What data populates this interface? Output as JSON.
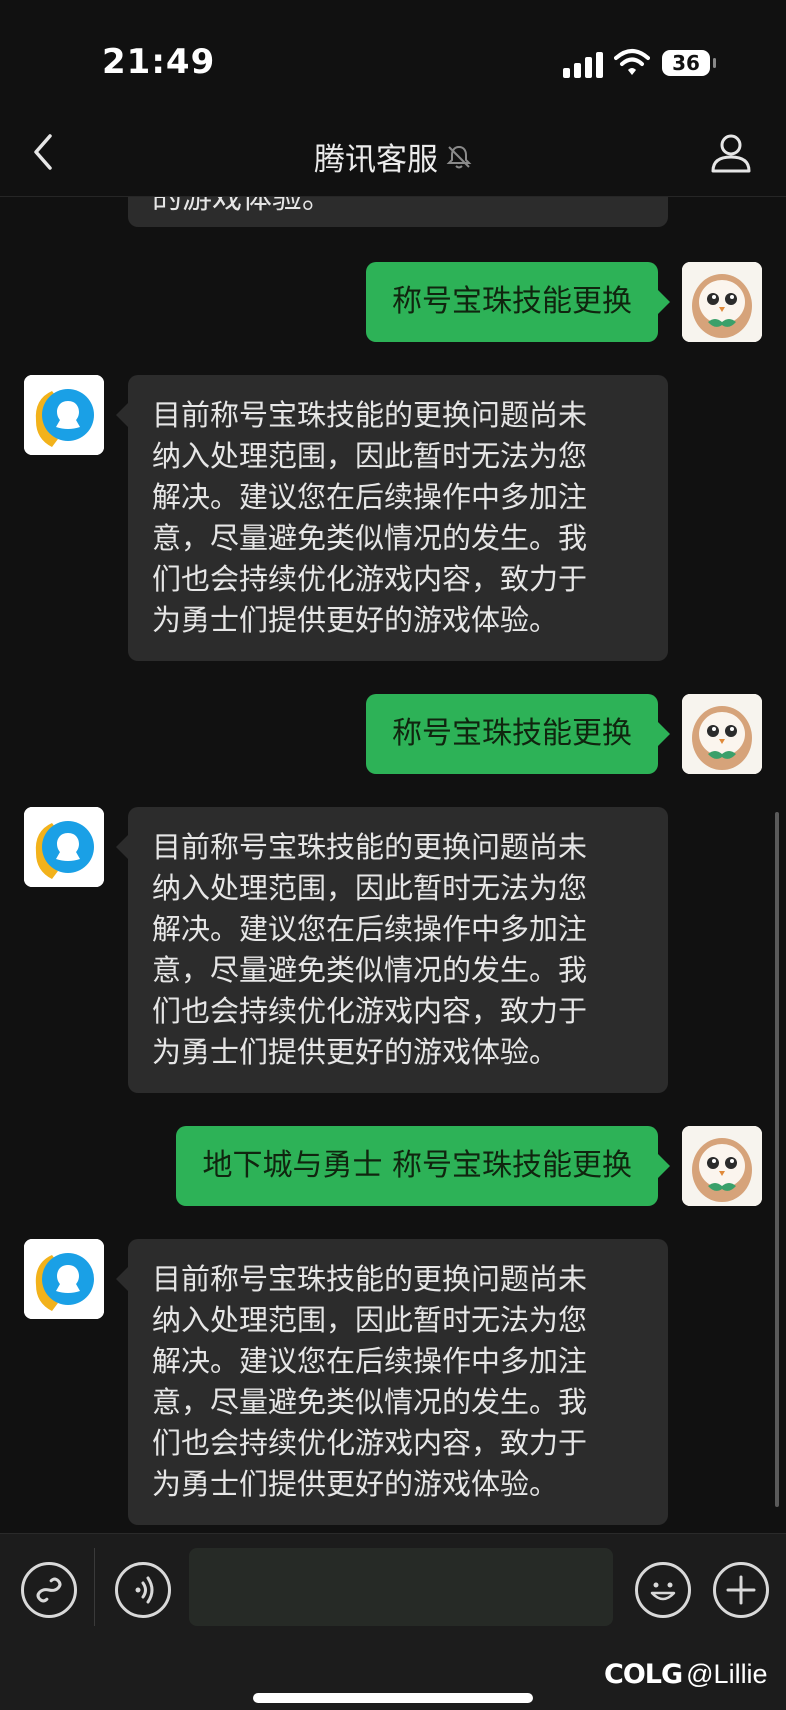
{
  "status_bar": {
    "time": "21:49",
    "battery": "36",
    "icons": [
      "signal-icon",
      "wifi-icon",
      "battery-icon"
    ]
  },
  "nav": {
    "title": "腾讯客服",
    "icons": [
      "back-icon",
      "mute-bell-icon",
      "profile-icon"
    ]
  },
  "clipped_message": {
    "text": "的游戏体验。"
  },
  "messages": [
    {
      "sender": "user",
      "text": "称号宝珠技能更换"
    },
    {
      "sender": "service",
      "lines": [
        "目前称号宝珠技能的更换问题尚未",
        "纳入处理范围，因此暂时无法为您",
        "解决。建议您在后续操作中多加注",
        "意，尽量避免类似情况的发生。我",
        "们也会持续优化游戏内容，致力于",
        "为勇士们提供更好的游戏体验。"
      ]
    },
    {
      "sender": "user",
      "text": "称号宝珠技能更换"
    },
    {
      "sender": "service",
      "lines": [
        "目前称号宝珠技能的更换问题尚未",
        "纳入处理范围，因此暂时无法为您",
        "解决。建议您在后续操作中多加注",
        "意，尽量避免类似情况的发生。我",
        "们也会持续优化游戏内容，致力于",
        "为勇士们提供更好的游戏体验。"
      ]
    },
    {
      "sender": "user",
      "text": "地下城与勇士 称号宝珠技能更换"
    },
    {
      "sender": "service",
      "lines": [
        "目前称号宝珠技能的更换问题尚未",
        "纳入处理范围，因此暂时无法为您",
        "解决。建议您在后续操作中多加注",
        "意，尽量避免类似情况的发生。我",
        "们也会持续优化游戏内容，致力于",
        "为勇士们提供更好的游戏体验。"
      ]
    }
  ],
  "input_bar": {
    "value": "",
    "icons": [
      "mini-program-icon",
      "voice-icon",
      "emoji-icon",
      "plus-icon"
    ]
  },
  "watermark": {
    "logo": "COLG",
    "text": "@Lillie"
  },
  "colors": {
    "background": "#111111",
    "outgoing_bubble": "#2db257",
    "incoming_bubble": "#2c2c2c",
    "service_avatar": "#1aa0e6"
  }
}
